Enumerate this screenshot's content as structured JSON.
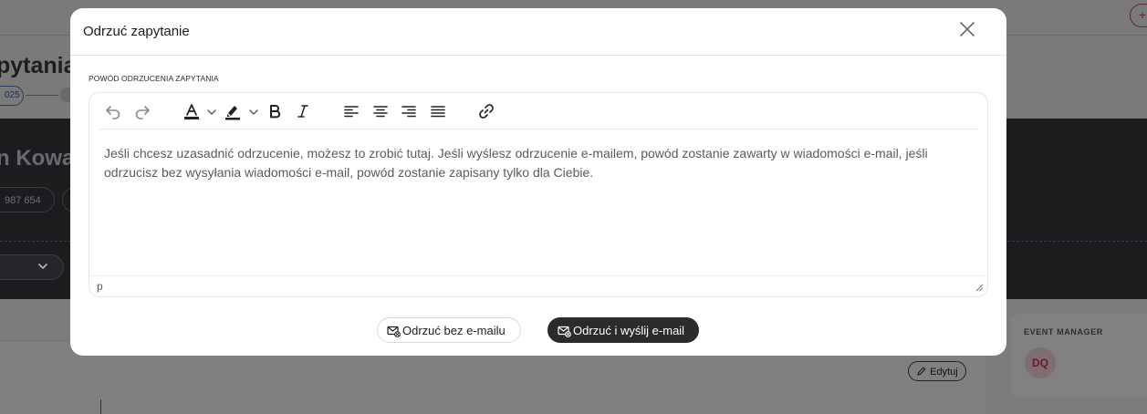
{
  "background": {
    "page_title_fragment": "pytania",
    "date_pill_fragment": "025",
    "client_name_fragment": "n Kowa",
    "phone_fragment": "987 654",
    "edit_label": "Edytuj",
    "event_manager_label": "EVENT MANAGER",
    "avatar_initials": "DQ",
    "add_icon": "+"
  },
  "modal": {
    "title": "Odrzuć zapytanie",
    "field_label": "POWÓD ODRZUCENIA ZAPYTANIA",
    "toolbar": {
      "icons": [
        "undo-icon",
        "redo-icon",
        "text-color-icon",
        "highlight-color-icon",
        "bold-icon",
        "italic-icon",
        "align-left-icon",
        "align-center-icon",
        "align-right-icon",
        "align-justify-icon",
        "link-icon"
      ]
    },
    "editor_text": "Jeśli chcesz uzasadnić odrzucenie, możesz to zrobić tutaj. Jeśli wyślesz odrzucenie e-mailem, powód zostanie zawarty w wiadomości e-mail, jeśli odrzucisz bez wysyłania wiadomości e-mail, powód zostanie zapisany tylko dla Ciebie.",
    "status_path": "p",
    "buttons": {
      "reject_without_email": "Odrzuć bez e-mailu",
      "reject_and_send": "Odrzuć i wyślij e-mail"
    },
    "colors": {
      "primary_button": "#2b2b2d",
      "overlay": "#7f7f7f",
      "avatar_text": "#6a1a2e"
    }
  }
}
